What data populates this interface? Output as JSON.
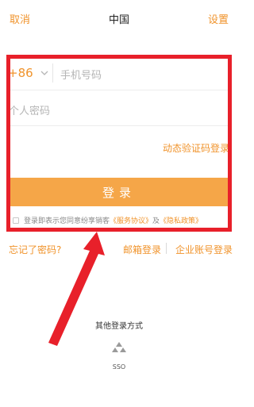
{
  "header": {
    "cancel": "取消",
    "title": "中国",
    "settings": "设置"
  },
  "form": {
    "country_code": "+86",
    "phone_placeholder": "手机号码",
    "password_placeholder": "个人密码",
    "dynamic_code_link": "动态验证码登录",
    "login_button": "登录",
    "agreement_prefix": "登录即表示您同意纷享销客",
    "service_agreement": "《服务协议》",
    "and": "及",
    "privacy_policy": "《隐私政策》"
  },
  "links": {
    "forgot_password": "忘记了密码?",
    "email_login": "邮箱登录",
    "corp_login": "企业账号登录"
  },
  "other_login": {
    "title": "其他登录方式",
    "sso_label": "SSO",
    "sso_icon": "sso-triangles-icon"
  },
  "colors": {
    "accent": "#f0932b",
    "button": "#f5a648",
    "highlight": "#e8202a"
  }
}
